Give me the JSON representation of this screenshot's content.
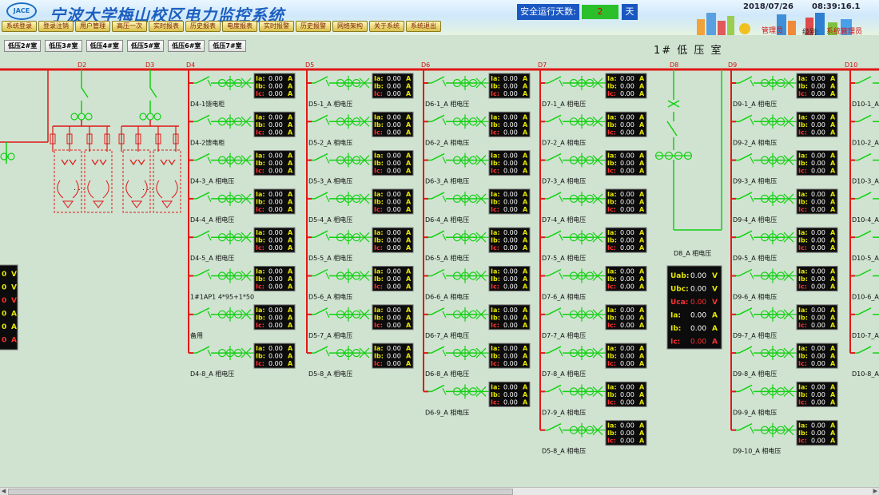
{
  "header": {
    "logo_text": "JACE",
    "title": "宁波大学梅山校区电力监控系统",
    "menu": [
      "系统登录",
      "登录注销",
      "用户管理",
      "高压一次",
      "实时报表",
      "历史报表",
      "电度报表",
      "实时报警",
      "历史报警",
      "网络架构",
      "关于系统",
      "系统退出"
    ],
    "safe_label": "安全运行天数:",
    "safe_days": "2",
    "safe_unit": "天",
    "date": "2018/07/26",
    "time": "08:39:16.1",
    "user_label": "管理员",
    "level_label": "级别:",
    "level_value": "系统管理员"
  },
  "tabs": [
    "低压2#室",
    "低压3#室",
    "低压4#室",
    "低压5#室",
    "低压6#室",
    "低压7#室"
  ],
  "room_title": "1# 低 压 室",
  "colors": {
    "bus": "#e01818",
    "switch": "#14d014",
    "panel": "#0c0c0c",
    "label": "#e6e600",
    "value": "#ffffff",
    "accent": "#1a57c2"
  },
  "bus_labels": [
    "D2",
    "D3",
    "D4",
    "D5",
    "D6",
    "D7",
    "D8",
    "D9",
    "D10"
  ],
  "meter_rows": [
    {
      "label": "Ia:",
      "value": "0.00",
      "unit": "A"
    },
    {
      "label": "Ib:",
      "value": "0.00",
      "unit": "A"
    },
    {
      "label": "Ic:",
      "value": "0.00",
      "unit": "A"
    }
  ],
  "left_meter": {
    "values": [
      "0",
      "0",
      "0",
      "0",
      "0",
      "0"
    ],
    "units": [
      "V",
      "V",
      "V",
      "A",
      "A",
      "A"
    ]
  },
  "d8_meter": {
    "title": "D8_A 相电压",
    "rows": [
      {
        "label": "Uab:",
        "value": "0.00",
        "unit": "V"
      },
      {
        "label": "Ubc:",
        "value": "0.00",
        "unit": "V"
      },
      {
        "label": "Uca:",
        "value": "0.00",
        "unit": "V"
      },
      {
        "label": "Ia:",
        "value": "0.00",
        "unit": "A"
      },
      {
        "label": "Ib:",
        "value": "0.00",
        "unit": "A"
      },
      {
        "label": "Ic:",
        "value": "0.00",
        "unit": "A"
      }
    ]
  },
  "feeders": {
    "D4": [
      "D4-1馈电柜",
      "D4-2馈电柜",
      "D4-3_A 相电压",
      "D4-4_A 相电压",
      "D4-5_A 相电压",
      "1#1AP1 4*95+1*50",
      "备用",
      "D4-8_A 相电压"
    ],
    "D5": [
      "D5-1_A 相电压",
      "D5-2_A 相电压",
      "D5-3_A 相电压",
      "D5-4_A 相电压",
      "D5-5_A 相电压",
      "D5-6_A 相电压",
      "D5-7_A 相电压",
      "D5-8_A 相电压"
    ],
    "D6": [
      "D6-1_A 相电压",
      "D6-2_A 相电压",
      "D6-3_A 相电压",
      "D6-4_A 相电压",
      "D6-5_A 相电压",
      "D6-6_A 相电压",
      "D6-7_A 相电压",
      "D6-8_A 相电压",
      "D6-9_A 相电压"
    ],
    "D7": [
      "D7-1_A 相电压",
      "D7-2_A 相电压",
      "D7-3_A 相电压",
      "D7-4_A 相电压",
      "D7-5_A 相电压",
      "D7-6_A 相电压",
      "D7-7_A 相电压",
      "D7-8_A 相电压",
      "D7-9_A 相电压",
      "D5-8_A 相电压"
    ],
    "D9": [
      "D9-1_A 相电压",
      "D9-2_A 相电压",
      "D9-3_A 相电压",
      "D9-4_A 相电压",
      "D9-5_A 相电压",
      "D9-6_A 相电压",
      "D9-7_A 相电压",
      "D9-8_A 相电压",
      "D9-9_A 相电压",
      "D9-10_A 相电压"
    ],
    "D10": [
      "D10-1_A",
      "D10-2_A",
      "D10-3_A",
      "D10-4_A",
      "D10-5_A",
      "D10-6_A",
      "D10-7_A",
      "D10-8_A"
    ]
  }
}
